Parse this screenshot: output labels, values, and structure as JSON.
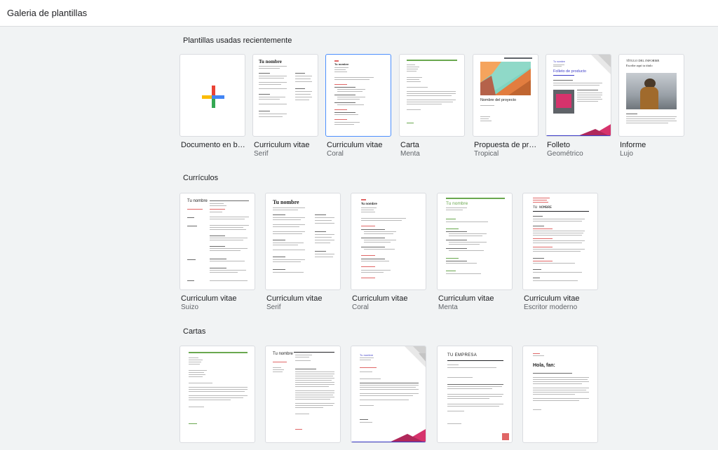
{
  "app": {
    "title": "Galeria de plantillas"
  },
  "sections": {
    "recent": {
      "title": "Plantillas usadas recientemente",
      "items": [
        {
          "title": "Documento en bla…",
          "subtitle": ""
        },
        {
          "title": "Curriculum vitae",
          "subtitle": "Serif"
        },
        {
          "title": "Curriculum vitae",
          "subtitle": "Coral"
        },
        {
          "title": "Carta",
          "subtitle": "Menta"
        },
        {
          "title": "Propuesta de proy…",
          "subtitle": "Tropical"
        },
        {
          "title": "Folleto",
          "subtitle": "Geométrico"
        },
        {
          "title": "Informe",
          "subtitle": "Lujo"
        }
      ]
    },
    "resumes": {
      "title": "Currículos",
      "items": [
        {
          "title": "Curriculum vitae",
          "subtitle": "Suizo"
        },
        {
          "title": "Curriculum vitae",
          "subtitle": "Serif"
        },
        {
          "title": "Curriculum vitae",
          "subtitle": "Coral"
        },
        {
          "title": "Curriculum vitae",
          "subtitle": "Menta"
        },
        {
          "title": "Curriculum vitae",
          "subtitle": "Escritor moderno"
        }
      ]
    },
    "letters": {
      "title": "Cartas"
    }
  },
  "thumb_text": {
    "tu_nombre": "Tu nombre",
    "tu_nombre_upper": "TU NOMBRE",
    "nombre_proyecto": "Nombre del proyecto",
    "folleto_producto": "Folleto de producto",
    "informe_title": "TÍTULO DEL INFORME",
    "informe_sub": "Escribe aquí tu título",
    "tu_empresa_upper": "TU EMPRESA",
    "hola": "Hola, fan:"
  },
  "colors": {
    "blue": "#4285f4",
    "red": "#ea4335",
    "yellow": "#fbbc05",
    "green": "#34a853",
    "coral": "#e06666",
    "mint": "#6aa84f",
    "selected_border": "#4d90fe"
  }
}
